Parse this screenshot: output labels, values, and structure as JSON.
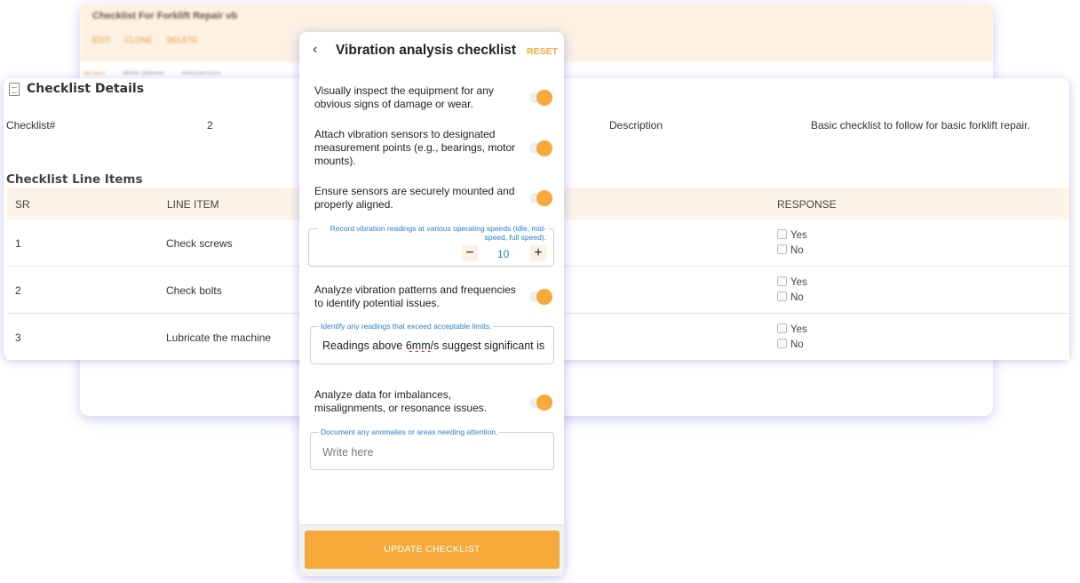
{
  "background_card": {
    "title": "Checklist For Forklift Repair vb",
    "actions": [
      "EDIT",
      "CLONE",
      "DELETE"
    ],
    "tabs": [
      "DETAILS",
      "WORK ORDERS",
      "ASSOCIATED A"
    ]
  },
  "details": {
    "heading": "Checklist Details",
    "checklist_label": "Checklist#",
    "checklist_value": "2",
    "description_label": "Description",
    "description_value": "Basic checklist to follow for basic forklift repair.",
    "line_items_title": "Checklist Line Items",
    "columns": {
      "sr": "SR",
      "line_item": "LINE ITEM",
      "response": "RESPONSE"
    },
    "rows": [
      {
        "sr": "1",
        "item": "Check screws",
        "yes": "Yes",
        "no": "No"
      },
      {
        "sr": "2",
        "item": "Check bolts",
        "yes": "Yes",
        "no": "No"
      },
      {
        "sr": "3",
        "item": "Lubricate the machine",
        "yes": "Yes",
        "no": "No"
      }
    ]
  },
  "panel": {
    "title": "Vibration analysis checklist",
    "reset_label": "RESET",
    "items": [
      {
        "text": "Visually inspect the equipment for any obvious signs of damage or wear.",
        "on": true
      },
      {
        "text": "Attach vibration sensors to designated measurement points (e.g., bearings, motor mounts).",
        "on": true
      },
      {
        "text": "Ensure sensors are securely mounted and properly aligned.",
        "on": true
      },
      {
        "text": "Analyze vibration patterns and frequencies to identify potential issues.",
        "on": true
      },
      {
        "text": "Analyze data for imbalances, misalignments, or resonance issues.",
        "on": true
      }
    ],
    "stepper": {
      "label": "Record vibration readings at various operating speeds (idle, mid-speed, full speed).",
      "value": "10"
    },
    "readings_field": {
      "label": "Identify any readings that exceed acceptable limits.",
      "value_prefix": "Readings above ",
      "value_flagged": "6mm",
      "value_suffix": "/s suggest significant is"
    },
    "anomalies_field": {
      "label": "Document any anomalies or areas needing attention.",
      "placeholder": "Write here"
    },
    "update_label": "UPDATE CHECKLIST"
  },
  "colors": {
    "accent": "#f7a93a",
    "label_blue": "#2a7fd1",
    "header_tint": "#fdf4e8"
  }
}
